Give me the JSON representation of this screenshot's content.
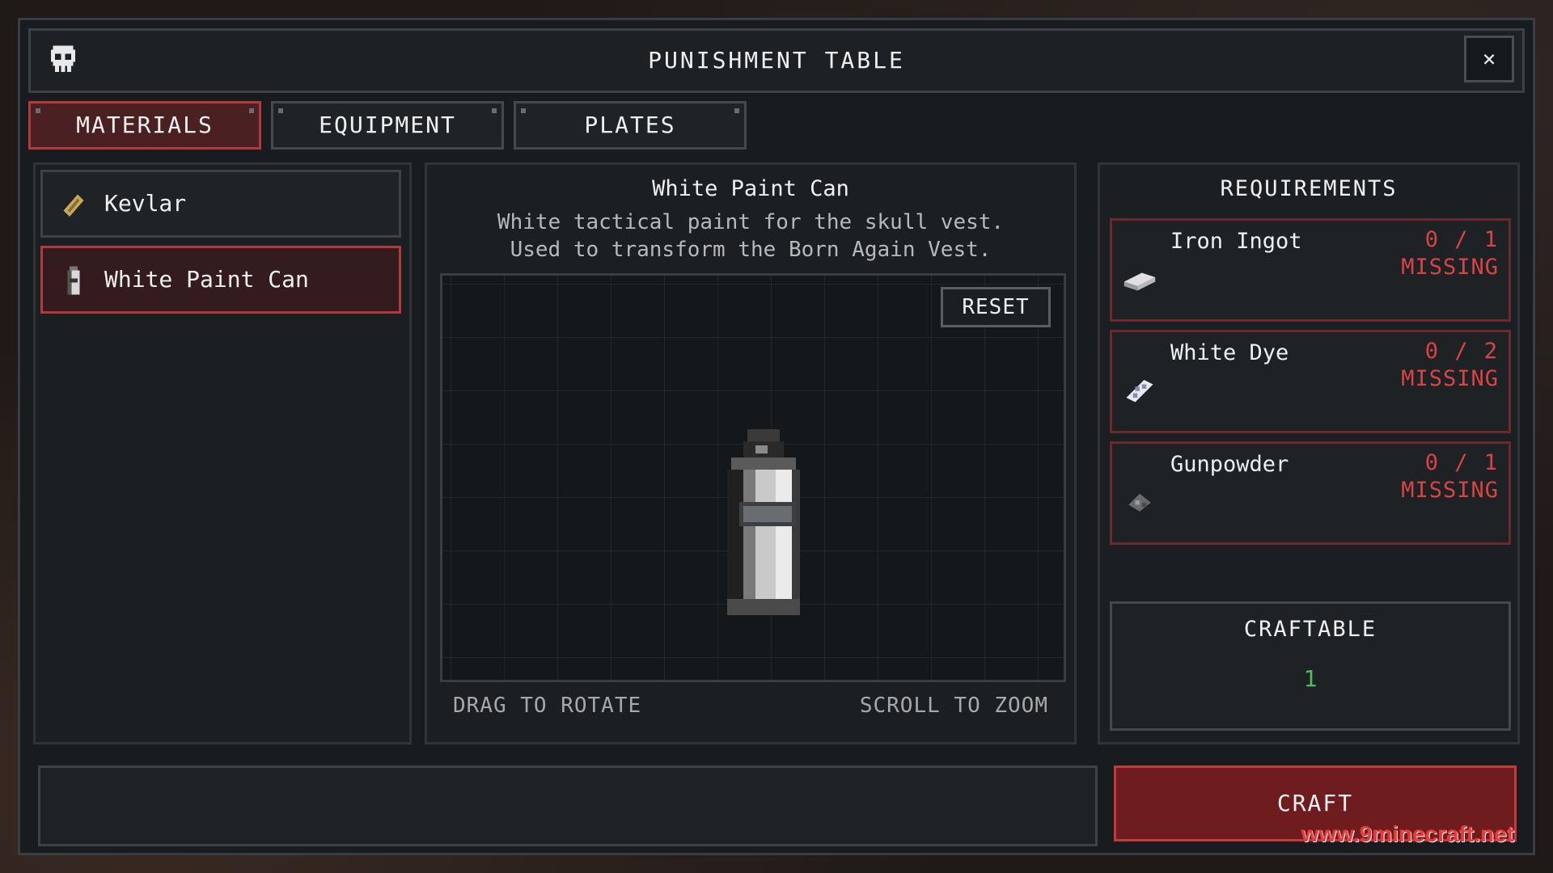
{
  "window": {
    "title": "PUNISHMENT TABLE",
    "close_label": "×"
  },
  "tabs": [
    {
      "label": "MATERIALS",
      "active": true
    },
    {
      "label": "EQUIPMENT",
      "active": false
    },
    {
      "label": "PLATES",
      "active": false
    }
  ],
  "materials": [
    {
      "label": "Kevlar",
      "icon": "kevlar-icon",
      "active": false
    },
    {
      "label": "White Paint Can",
      "icon": "paint-can-icon",
      "active": true
    }
  ],
  "detail": {
    "title": "White Paint Can",
    "description_line1": "White tactical paint for the skull vest.",
    "description_line2": "Used to transform the Born Again Vest.",
    "reset_label": "RESET",
    "hint_rotate": "DRAG TO ROTATE",
    "hint_zoom": "SCROLL TO ZOOM"
  },
  "requirements": {
    "title": "REQUIREMENTS",
    "items": [
      {
        "name": "Iron Ingot",
        "count": "0 / 1",
        "status": "MISSING",
        "icon": "iron-ingot-icon"
      },
      {
        "name": "White Dye",
        "count": "0 / 2",
        "status": "MISSING",
        "icon": "white-dye-icon"
      },
      {
        "name": "Gunpowder",
        "count": "0 / 1",
        "status": "MISSING",
        "icon": "gunpowder-icon"
      }
    ]
  },
  "craftable": {
    "label": "CRAFTABLE",
    "value": "1"
  },
  "craft_button": "CRAFT",
  "watermark": "www.9minecraft.net",
  "colors": {
    "accent_red": "#b23a3a",
    "missing_red": "#d84444",
    "craftable_green": "#4cc05a"
  }
}
